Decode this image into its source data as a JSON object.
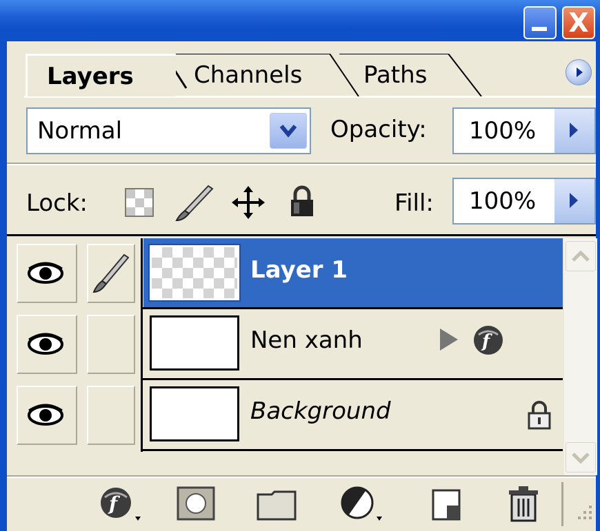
{
  "window": {
    "minimize_icon": "minimize-icon",
    "close_icon": "close-icon",
    "close_glyph": "X"
  },
  "tabs": [
    {
      "label": "Layers",
      "active": true
    },
    {
      "label": "Channels",
      "active": false
    },
    {
      "label": "Paths",
      "active": false
    }
  ],
  "blend": {
    "mode": "Normal"
  },
  "opacity": {
    "label": "Opacity:",
    "value": "100%"
  },
  "lock": {
    "label": "Lock:",
    "icons": [
      "lock-transparency-icon",
      "lock-image-icon",
      "lock-position-icon",
      "lock-all-icon"
    ]
  },
  "fill": {
    "label": "Fill:",
    "value": "100%"
  },
  "layers": [
    {
      "name": "Layer 1",
      "visible": true,
      "selected": true,
      "brush_linked": true
    },
    {
      "name": "Nen xanh",
      "visible": true,
      "selected": false,
      "has_effects": true
    },
    {
      "name": "Background",
      "visible": true,
      "selected": false,
      "locked": true,
      "italic": true
    }
  ],
  "toolbar": {
    "icons": [
      "layer-style-icon",
      "layer-mask-icon",
      "new-group-icon",
      "adjustment-layer-icon",
      "new-layer-icon",
      "delete-layer-icon"
    ]
  },
  "colors": {
    "titlebar": "#0d4fc8",
    "panel": "#ece9d8",
    "selection": "#316ac5",
    "field_border": "#7f9db9"
  }
}
